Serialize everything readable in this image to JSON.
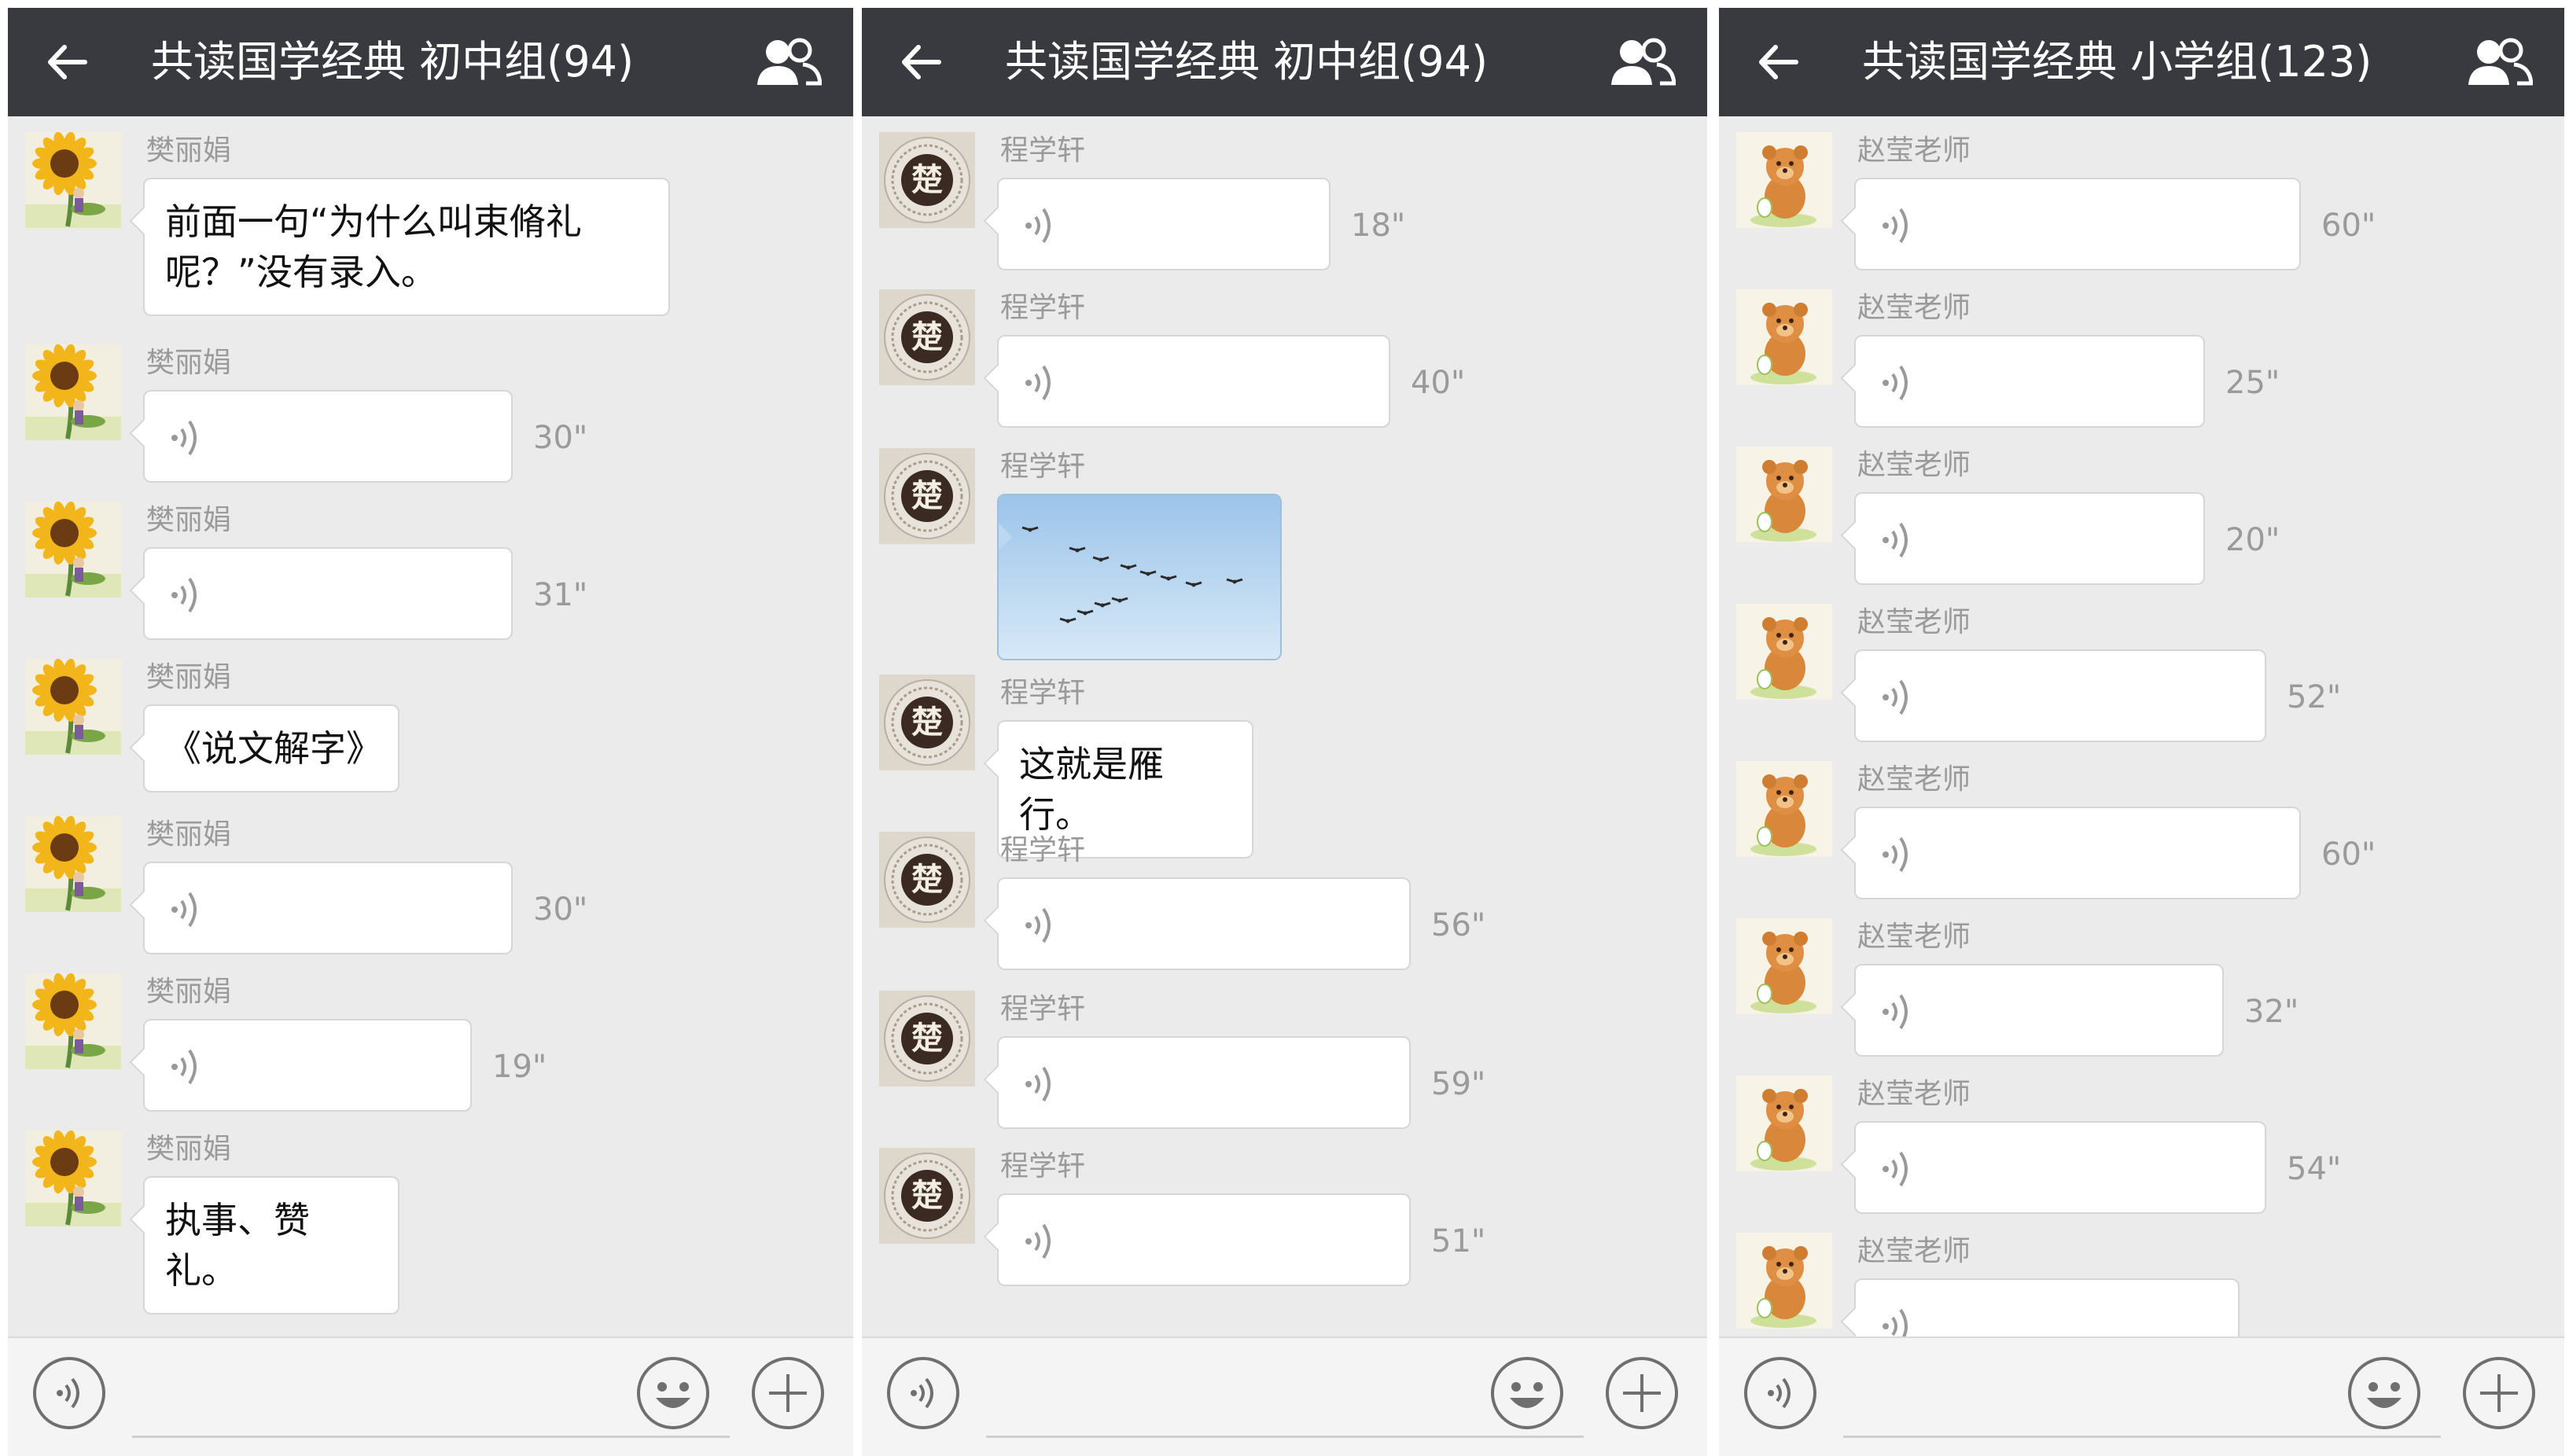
{
  "icons": {
    "back": "back-arrow-icon",
    "group": "group-members-icon",
    "voice_toggle": "voice-input-icon",
    "emoji": "emoji-icon",
    "plus": "plus-icon",
    "voice_wave": "voice-wave-icon"
  },
  "colors": {
    "header_bg": "#393a3f",
    "chat_bg": "#ebebeb",
    "bubble_bg": "#ffffff",
    "meta_text": "#9a9a9a"
  },
  "panels": [
    {
      "title": "共读国学经典 初中组(94)",
      "avatar": "sunflower",
      "messages": [
        {
          "sender": "樊丽娟",
          "type": "text",
          "text": "前面一句“为什么叫束脩礼呢？”没有录入。"
        },
        {
          "sender": "樊丽娟",
          "type": "voice",
          "duration": "30\""
        },
        {
          "sender": "樊丽娟",
          "type": "voice",
          "duration": "31\""
        },
        {
          "sender": "樊丽娟",
          "type": "text",
          "text": "《说文解字》"
        },
        {
          "sender": "樊丽娟",
          "type": "voice",
          "duration": "30\""
        },
        {
          "sender": "樊丽娟",
          "type": "voice",
          "duration": "19\""
        },
        {
          "sender": "樊丽娟",
          "type": "text",
          "text": "执事、赞礼。"
        }
      ]
    },
    {
      "title": "共读国学经典 初中组(94)",
      "avatar": "chu-seal",
      "avatar_text": "楚",
      "messages": [
        {
          "sender": "程学轩",
          "type": "voice",
          "duration": "18\""
        },
        {
          "sender": "程学轩",
          "type": "voice",
          "duration": "40\""
        },
        {
          "sender": "程学轩",
          "type": "image",
          "image": "geese-flying-in-sky-photo"
        },
        {
          "sender": "程学轩",
          "type": "text",
          "text": "这就是雁行。"
        },
        {
          "sender": "程学轩",
          "type": "voice",
          "duration": "56\""
        },
        {
          "sender": "程学轩",
          "type": "voice",
          "duration": "59\""
        },
        {
          "sender": "程学轩",
          "type": "voice",
          "duration": "51\""
        }
      ]
    },
    {
      "title": "共读国学经典 小学组(123)",
      "avatar": "teddy-bear",
      "messages": [
        {
          "sender": "赵莹老师",
          "type": "voice",
          "duration": "60\""
        },
        {
          "sender": "赵莹老师",
          "type": "voice",
          "duration": "25\""
        },
        {
          "sender": "赵莹老师",
          "type": "voice",
          "duration": "20\""
        },
        {
          "sender": "赵莹老师",
          "type": "voice",
          "duration": "52\""
        },
        {
          "sender": "赵莹老师",
          "type": "voice",
          "duration": "60\""
        },
        {
          "sender": "赵莹老师",
          "type": "voice",
          "duration": "32\""
        },
        {
          "sender": "赵莹老师",
          "type": "voice",
          "duration": "54\""
        },
        {
          "sender": "赵莹老师",
          "type": "voice",
          "duration": ""
        }
      ]
    }
  ]
}
